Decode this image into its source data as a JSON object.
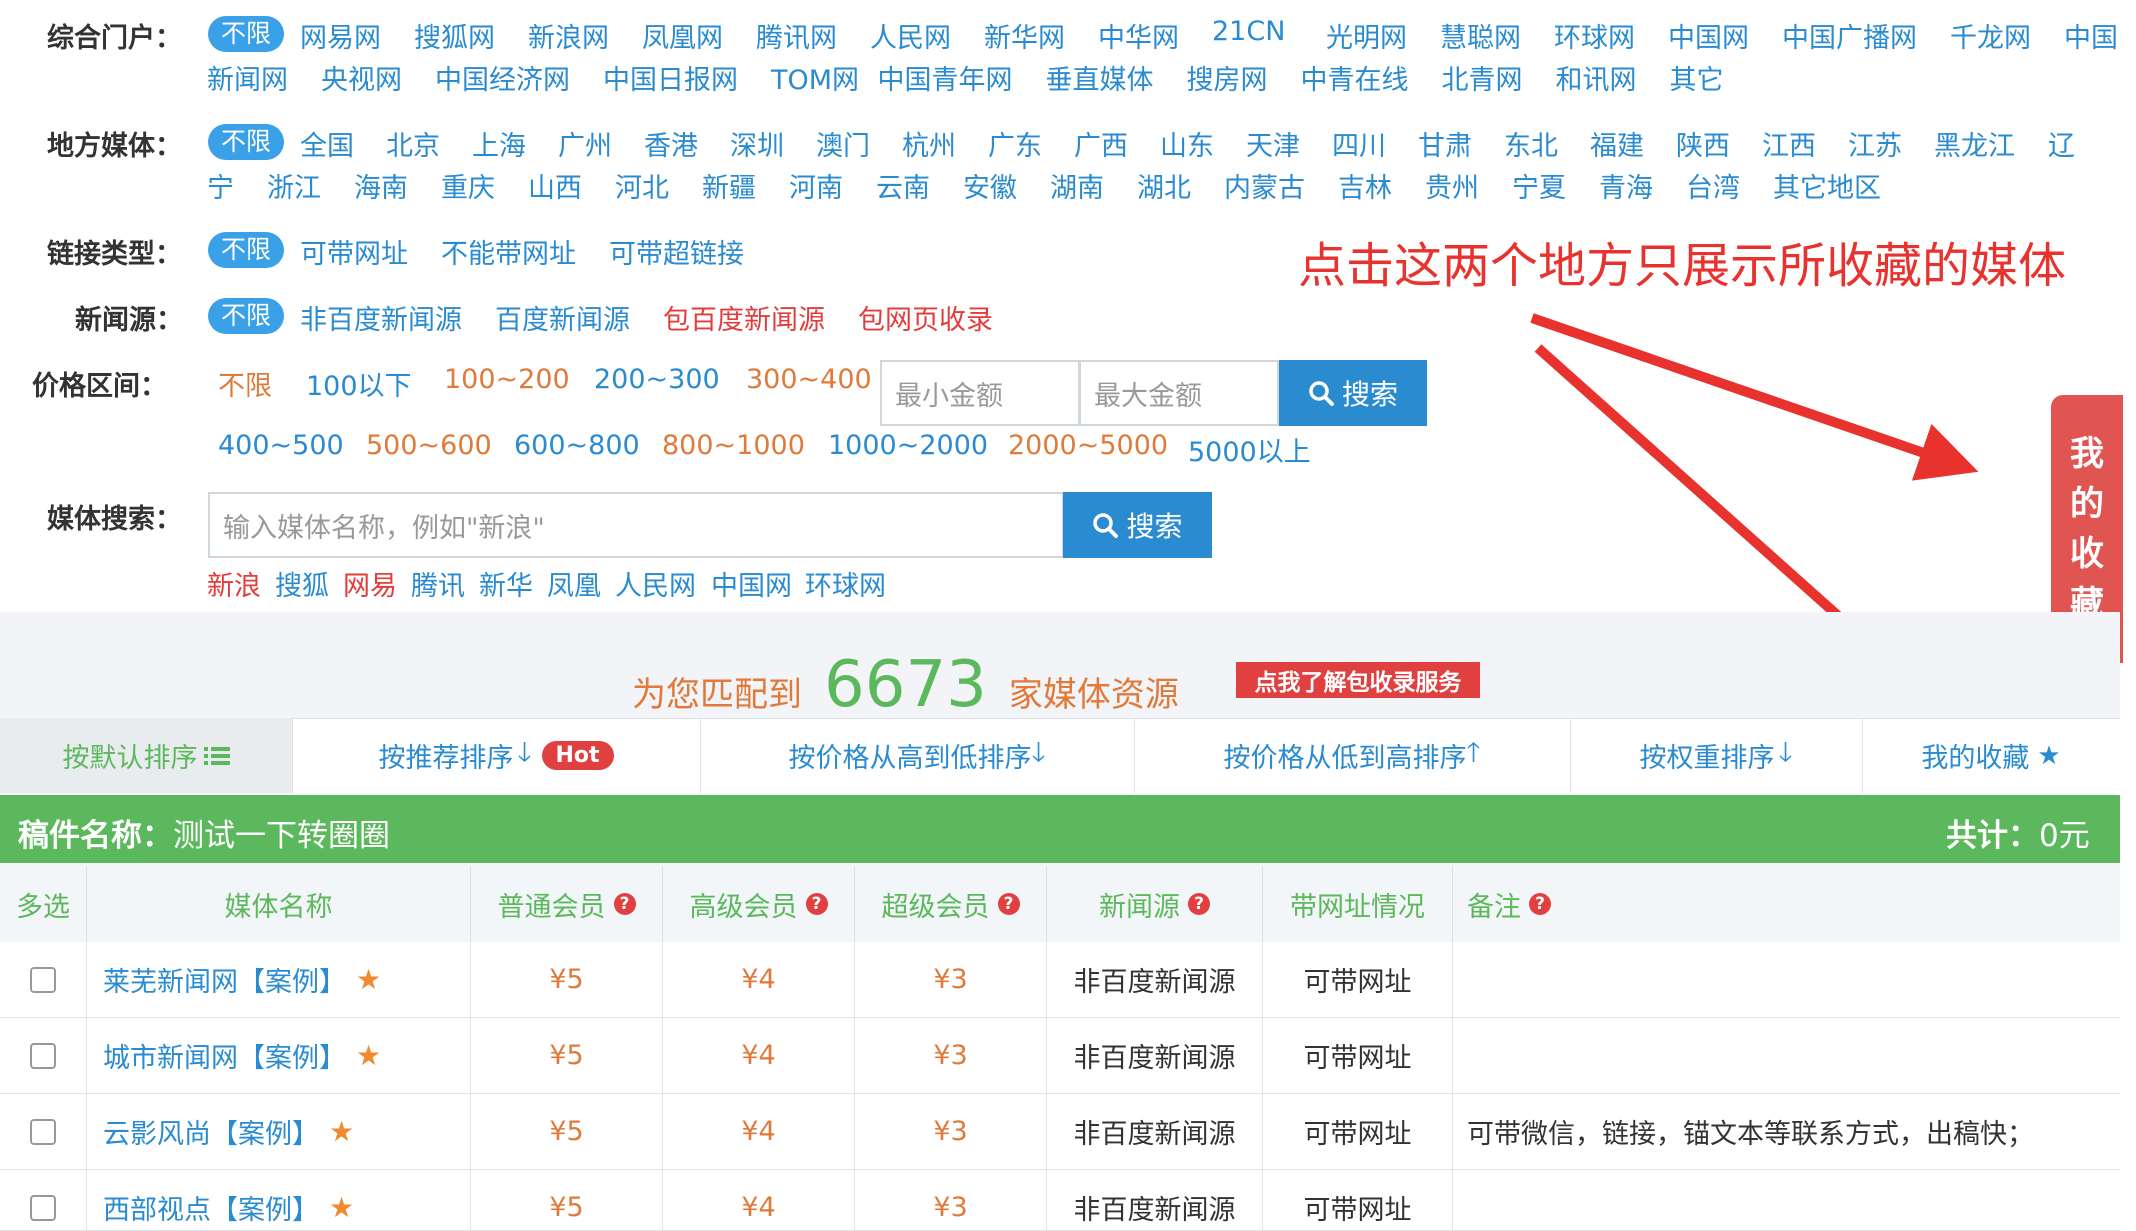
{
  "filters": {
    "portal": {
      "label": "综合门户：",
      "all": "不限",
      "row1": [
        "网易网",
        "搜狐网",
        "新浪网",
        "凤凰网",
        "腾讯网",
        "人民网",
        "新华网",
        "中华网",
        "21CN",
        "光明网",
        "慧聪网",
        "环球网",
        "中国网",
        "中国广播网",
        "千龙网",
        "中国"
      ],
      "row2": [
        "新闻网",
        "央视网",
        "中国经济网",
        "中国日报网",
        "TOM网",
        "中国青年网",
        "垂直媒体",
        "搜房网",
        "中青在线",
        "北青网",
        "和讯网",
        "其它"
      ]
    },
    "region": {
      "label": "地方媒体：",
      "all": "不限",
      "row1": [
        "全国",
        "北京",
        "上海",
        "广州",
        "香港",
        "深圳",
        "澳门",
        "杭州",
        "广东",
        "广西",
        "山东",
        "天津",
        "四川",
        "甘肃",
        "东北",
        "福建",
        "陕西",
        "江西",
        "江苏",
        "黑龙江",
        "辽"
      ],
      "row2": [
        "宁",
        "浙江",
        "海南",
        "重庆",
        "山西",
        "河北",
        "新疆",
        "河南",
        "云南",
        "安徽",
        "湖南",
        "湖北",
        "内蒙古",
        "吉林",
        "贵州",
        "宁夏",
        "青海",
        "台湾",
        "其它地区"
      ]
    },
    "link_type": {
      "label": "链接类型：",
      "all": "不限",
      "items": [
        "可带网址",
        "不能带网址",
        "可带超链接"
      ]
    },
    "news_source": {
      "label": "新闻源：",
      "all": "不限",
      "items": [
        "非百度新闻源",
        "百度新闻源",
        "包百度新闻源",
        "包网页收录"
      ]
    },
    "price": {
      "label": "价格区间：",
      "row1": [
        "不限",
        "100以下",
        "100~200",
        "200~300",
        "300~400"
      ],
      "row2": [
        "400~500",
        "500~600",
        "600~800",
        "800~1000",
        "1000~2000",
        "2000~5000",
        "5000以上"
      ],
      "min_placeholder": "最小金额",
      "max_placeholder": "最大金额",
      "search_label": "搜索"
    },
    "media_search": {
      "label": "媒体搜索：",
      "placeholder": "输入媒体名称，例如\"新浪\"",
      "search_label": "搜索",
      "quick": [
        "新浪",
        "搜狐",
        "网易",
        "腾讯",
        "新华",
        "凤凰",
        "人民网",
        "中国网",
        "环球网"
      ]
    }
  },
  "annotation": {
    "text": "点击这两个地方只展示所收藏的媒体",
    "color": "#e8322e"
  },
  "side_tab": {
    "chars": [
      "我",
      "的",
      "收",
      "藏"
    ]
  },
  "match": {
    "prefix": "为您匹配到",
    "count": "6673",
    "suffix": "家媒体资源",
    "service_button": "点我了解包收录服务"
  },
  "sort_tabs": {
    "default": "按默认排序",
    "recommend": "按推荐排序",
    "hot_badge": "Hot",
    "price_desc": "按价格从高到低排序",
    "price_asc": "按价格从低到高排序",
    "weight": "按权重排序",
    "favorites": "我的收藏"
  },
  "manuscript": {
    "label": "稿件名称：",
    "name": "测试一下转圈圈",
    "total_label": "共计：",
    "total": "0元"
  },
  "table": {
    "headers": [
      "多选",
      "媒体名称",
      "普通会员",
      "高级会员",
      "超级会员",
      "新闻源",
      "带网址情况",
      "备注"
    ],
    "rows": [
      {
        "name": "莱芜新闻网",
        "case": "【案例】",
        "p1": "¥5",
        "p2": "¥4",
        "p3": "¥3",
        "source": "非百度新闻源",
        "url": "可带网址",
        "note": ""
      },
      {
        "name": "城市新闻网",
        "case": "【案例】",
        "p1": "¥5",
        "p2": "¥4",
        "p3": "¥3",
        "source": "非百度新闻源",
        "url": "可带网址",
        "note": ""
      },
      {
        "name": "云影风尚",
        "case": "【案例】",
        "p1": "¥5",
        "p2": "¥4",
        "p3": "¥3",
        "source": "非百度新闻源",
        "url": "可带网址",
        "note": "可带微信，链接，锚文本等联系方式，出稿快；"
      },
      {
        "name": "西部视点",
        "case": "【案例】",
        "p1": "¥5",
        "p2": "¥4",
        "p3": "¥3",
        "source": "非百度新闻源",
        "url": "可带网址",
        "note": ""
      }
    ]
  },
  "colors": {
    "link_blue": "#2a8bd0",
    "orange": "#e07a3a",
    "green": "#5cb85c",
    "arrow_red": "#e8322e"
  }
}
